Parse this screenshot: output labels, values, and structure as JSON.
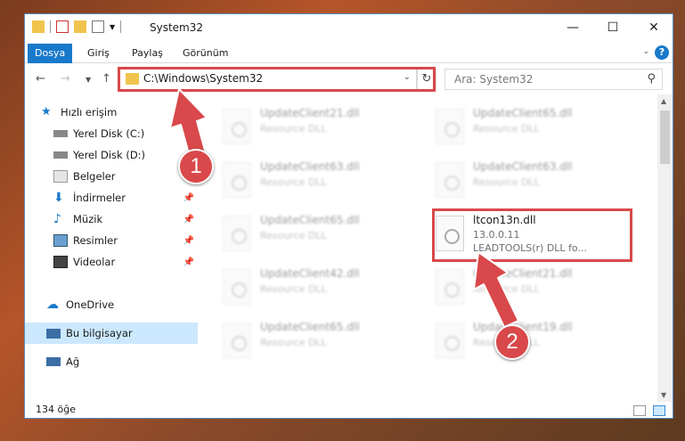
{
  "window": {
    "title": "System32"
  },
  "ribbon": {
    "tabs": [
      "Dosya",
      "Giriş",
      "Paylaş",
      "Görünüm"
    ]
  },
  "address": {
    "path": "C:\\Windows\\System32"
  },
  "search": {
    "placeholder": "Ara: System32"
  },
  "sidebar": {
    "items": [
      {
        "label": "Hızlı erişim",
        "icon": "star-icon"
      },
      {
        "label": "Yerel Disk (C:)",
        "icon": "drive-icon"
      },
      {
        "label": "Yerel Disk (D:)",
        "icon": "drive-icon"
      },
      {
        "label": "Belgeler",
        "icon": "documents-icon"
      },
      {
        "label": "İndirmeler",
        "icon": "download-icon"
      },
      {
        "label": "Müzik",
        "icon": "music-icon"
      },
      {
        "label": "Resimler",
        "icon": "pictures-icon"
      },
      {
        "label": "Videolar",
        "icon": "video-icon"
      },
      {
        "label": "OneDrive",
        "icon": "cloud-icon"
      },
      {
        "label": "Bu bilgisayar",
        "icon": "computer-icon"
      },
      {
        "label": "Ağ",
        "icon": "network-icon"
      }
    ]
  },
  "files": [
    {
      "name": "UpdateClient21.dll",
      "desc": "Resource DLL"
    },
    {
      "name": "UpdateClient65.dll",
      "desc": "Resource DLL"
    },
    {
      "name": "UpdateClient63.dll",
      "desc": "Resource DLL"
    },
    {
      "name": "UpdateClient63.dll",
      "desc": "Resource DLL"
    },
    {
      "name": "UpdateClient65.dll",
      "desc": "Resource DLL"
    },
    {
      "name": "UpdateClient42.dll",
      "desc": "Resource DLL"
    },
    {
      "name": "UpdateClient21.dll",
      "desc": "Resource DLL"
    },
    {
      "name": "UpdateClient65.dll",
      "desc": "Resource DLL"
    },
    {
      "name": "UpdateClient19.dll",
      "desc": "Resource DLL"
    }
  ],
  "highlighted_file": {
    "name": "ltcon13n.dll",
    "version": "13.0.0.11",
    "desc": "LEADTOOLS(r) DLL fo..."
  },
  "status": {
    "count": "134 öğe"
  },
  "annotations": {
    "badge1": "1",
    "badge2": "2",
    "color": "#d9484a"
  }
}
